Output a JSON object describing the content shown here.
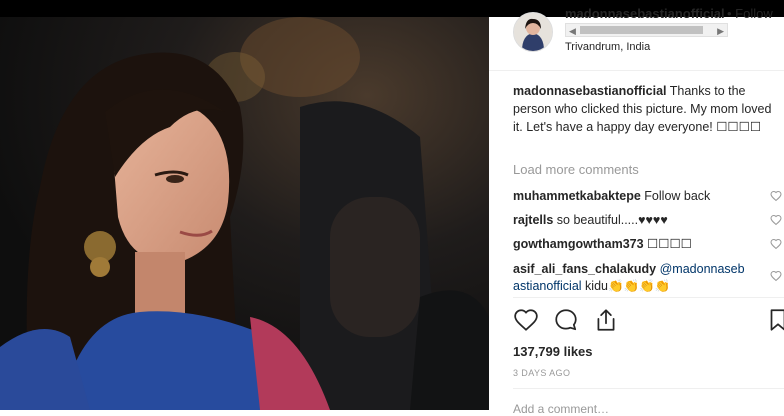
{
  "post": {
    "username": "madonnasebastianofficial",
    "follow_label": "• Follow",
    "location": "Trivandrum, India"
  },
  "caption": {
    "username": "madonnasebastianofficial",
    "text": " Thanks to the person who clicked this picture. My mom loved it. Let's have a happy day everyone! ☐☐☐☐"
  },
  "load_more": "Load more comments",
  "comments": [
    {
      "username": "muhammetkabaktepe",
      "text": " Follow back"
    },
    {
      "username": "rajtells",
      "text": " so beautiful.....♥♥♥♥"
    },
    {
      "username": "gowthamgowtham373",
      "text": " ☐☐☐☐"
    },
    {
      "username": "asif_ali_fans_chalakudy",
      "mention_a": " @madonnaseb",
      "mention_b": "astianofficial",
      "text": " kidu👏👏👏👏"
    }
  ],
  "likes": "137,799 likes",
  "date": "3 DAYS AGO",
  "add_comment_placeholder": "Add a comment…",
  "icons": {
    "like": "heart-icon",
    "comment": "comment-icon",
    "share": "share-icon",
    "save": "bookmark-icon",
    "scroll_left": "◀",
    "scroll_right": "▶"
  }
}
